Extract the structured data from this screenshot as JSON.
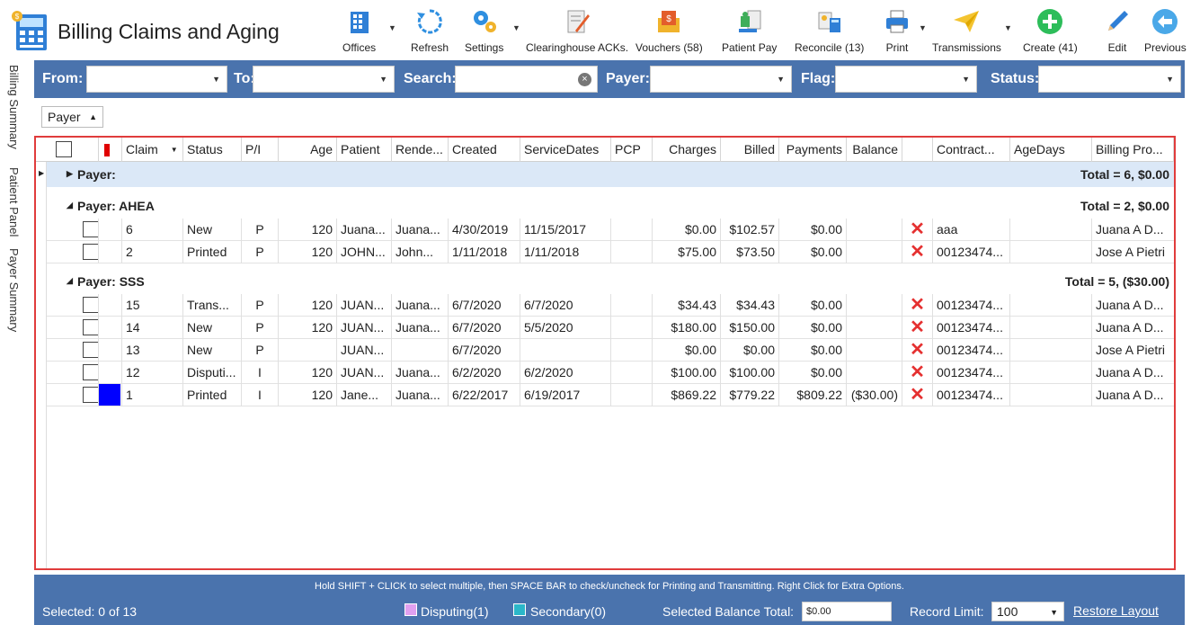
{
  "app": {
    "title": "Billing Claims and Aging"
  },
  "toolbar": [
    {
      "label": "Offices",
      "icon": "offices-icon",
      "caret": true
    },
    {
      "label": "Refresh",
      "icon": "refresh-icon",
      "caret": false
    },
    {
      "label": "Settings",
      "icon": "settings-icon",
      "caret": true
    },
    {
      "label": "Clearinghouse ACKs.",
      "icon": "clearinghouse-icon",
      "caret": false
    },
    {
      "label": "Vouchers (58)",
      "icon": "vouchers-icon",
      "caret": false
    },
    {
      "label": "Patient Pay",
      "icon": "patient-pay-icon",
      "caret": false
    },
    {
      "label": "Reconcile (13)",
      "icon": "reconcile-icon",
      "caret": false
    },
    {
      "label": "Print",
      "icon": "printer-icon",
      "caret": true
    },
    {
      "label": "Transmissions",
      "icon": "paper-plane-icon",
      "caret": true
    },
    {
      "label": "Create (41)",
      "icon": "plus-circle-icon",
      "caret": false
    },
    {
      "label": "Edit",
      "icon": "pencil-icon",
      "caret": false
    },
    {
      "label": "Previous",
      "icon": "back-arrow-icon",
      "caret": false
    }
  ],
  "side_tabs": [
    "Billing Summary",
    "Patient Panel",
    "Payer Summary"
  ],
  "filters": {
    "from_label": "From:",
    "to_label": "To:",
    "search_label": "Search:",
    "payer_label": "Payer:",
    "flag_label": "Flag:",
    "status_label": "Status:"
  },
  "group_by": {
    "label": "Payer"
  },
  "columns": [
    "",
    "",
    "Claim",
    "Status",
    "P/I",
    "Age",
    "Patient",
    "Rende...",
    "Created",
    "ServiceDates",
    "PCP",
    "Charges",
    "Billed",
    "Payments",
    "Balance",
    "",
    "Contract...",
    "AgeDays",
    "Billing Pro..."
  ],
  "groups": [
    {
      "title": "Payer:",
      "total": "Total = 6,  $0.00",
      "expanded": false,
      "rows": []
    },
    {
      "title": "Payer: AHEA",
      "total": "Total = 2,  $0.00",
      "expanded": true,
      "rows": [
        {
          "claim": "6",
          "status": "New",
          "pi": "P",
          "age": "120",
          "patient": "Juana...",
          "rendering": "Juana...",
          "created": "4/30/2019",
          "service": "11/15/2017",
          "pcp": "",
          "charges": "$0.00",
          "billed": "$102.57",
          "payments": "$0.00",
          "balance": "",
          "contract": "aaa",
          "agedays": "",
          "provider": "Juana A D...",
          "flag": ""
        },
        {
          "claim": "2",
          "status": "Printed",
          "pi": "P",
          "age": "120",
          "patient": "JOHN...",
          "rendering": "John...",
          "created": "1/11/2018",
          "service": "1/11/2018",
          "pcp": "",
          "charges": "$75.00",
          "billed": "$73.50",
          "payments": "$0.00",
          "balance": "",
          "contract": "00123474...",
          "agedays": "",
          "provider": "Jose A Pietri",
          "flag": ""
        }
      ]
    },
    {
      "title": "Payer: SSS",
      "total": "Total = 5,  ($30.00)",
      "expanded": true,
      "rows": [
        {
          "claim": "15",
          "status": "Trans...",
          "pi": "P",
          "age": "120",
          "patient": "JUAN...",
          "rendering": "Juana...",
          "created": "6/7/2020",
          "service": "6/7/2020",
          "pcp": "",
          "charges": "$34.43",
          "billed": "$34.43",
          "payments": "$0.00",
          "balance": "",
          "contract": "00123474...",
          "agedays": "",
          "provider": "Juana A D...",
          "flag": ""
        },
        {
          "claim": "14",
          "status": "New",
          "pi": "P",
          "age": "120",
          "patient": "JUAN...",
          "rendering": "Juana...",
          "created": "6/7/2020",
          "service": "5/5/2020",
          "pcp": "",
          "charges": "$180.00",
          "billed": "$150.00",
          "payments": "$0.00",
          "balance": "",
          "contract": "00123474...",
          "agedays": "",
          "provider": "Juana A D...",
          "flag": ""
        },
        {
          "claim": "13",
          "status": "New",
          "pi": "P",
          "age": "",
          "patient": "JUAN...",
          "rendering": "",
          "created": "6/7/2020",
          "service": "",
          "pcp": "",
          "charges": "$0.00",
          "billed": "$0.00",
          "payments": "$0.00",
          "balance": "",
          "contract": "00123474...",
          "agedays": "",
          "provider": "Jose A Pietri",
          "flag": ""
        },
        {
          "claim": "12",
          "status": "Disputi...",
          "pi": "I",
          "age": "120",
          "patient": "JUAN...",
          "rendering": "Juana...",
          "created": "6/2/2020",
          "service": "6/2/2020",
          "pcp": "",
          "charges": "$100.00",
          "billed": "$100.00",
          "payments": "$0.00",
          "balance": "",
          "contract": "00123474...",
          "agedays": "",
          "provider": "Juana A D...",
          "flag": ""
        },
        {
          "claim": "1",
          "status": "Printed",
          "pi": "I",
          "age": "120",
          "patient": "Jane...",
          "rendering": "Juana...",
          "created": "6/22/2017",
          "service": "6/19/2017",
          "pcp": "",
          "charges": "$869.22",
          "billed": "$779.22",
          "payments": "$809.22",
          "balance": "($30.00)",
          "contract": "00123474...",
          "agedays": "",
          "provider": "Juana A D...",
          "flag": "#0000ff"
        }
      ]
    }
  ],
  "footer": {
    "hint": "Hold SHIFT + CLICK to select multiple, then SPACE BAR to check/uncheck for Printing and Transmitting. Right Click for Extra Options.",
    "selected": "Selected: 0 of 13",
    "disputing_label": "Disputing(1)",
    "disputing_color": "#e0a0f0",
    "secondary_label": "Secondary(0)",
    "secondary_color": "#2bb7c9",
    "balance_label": "Selected Balance Total:",
    "balance_value": "$0.00",
    "record_limit_label": "Record Limit:",
    "record_limit_value": "100",
    "restore_label": "Restore Layout"
  },
  "colors": {
    "accent": "#4a73ad",
    "highlight_border": "#e03c3c",
    "group_bg": "#dbe8f7",
    "flag_red": "#e00000",
    "delete_red": "#e53030"
  }
}
